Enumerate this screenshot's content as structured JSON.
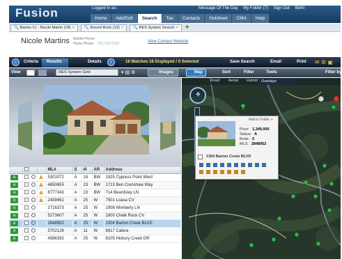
{
  "header": {
    "logo": "Fusion",
    "logged_in": "Logged in as:",
    "top_links": [
      "Message Of The Day",
      "My Folder (7)",
      "Sign Out",
      "BeNI"
    ],
    "nav_tabs": [
      "Home",
      "Add/Edit",
      "Search",
      "Tax",
      "Contacts",
      "Hotsheet",
      "CMA",
      "Help"
    ],
    "active_nav": "Search"
  },
  "doc_tabs": [
    "Barton Cr - Nicole Martin (18)",
    "Round Rock (13)",
    "RES System Search"
  ],
  "contact": {
    "name": "Nicole Martins",
    "mobile_label": "Mobile Phone",
    "home_label": "Home Phone",
    "phone_value": "555-555-5555",
    "website_link": "View Contact Website"
  },
  "toolbar1": {
    "criteria": "Criteria",
    "results": "Results",
    "details": "Details",
    "counts": "18 Matches   18 Displayed / 0 Selected",
    "save_search": "Save Search",
    "email": "Email",
    "print": "Print"
  },
  "toolbar2": {
    "view_label": "View",
    "grid_select": "RES System Grid",
    "images": "Images",
    "map": "Map",
    "sort": "Sort",
    "filter": "Filter",
    "tools": "Tools",
    "filter_by": "Filter by"
  },
  "grid": {
    "columns": [
      "ML#",
      "S",
      "#I",
      "AR",
      "Address"
    ],
    "rows": [
      {
        "status": "A",
        "ml": "5301072",
        "s": "A",
        "i": "14",
        "ar": "BW",
        "address": "1925 Cypress Point West",
        "warn": true
      },
      {
        "status": "A",
        "ml": "4650655",
        "s": "A",
        "i": "23",
        "ar": "BW",
        "address": "1713 Ben Crenshaw Way",
        "warn": true
      },
      {
        "status": "A",
        "ml": "6777343",
        "s": "A",
        "i": "23",
        "ar": "BW",
        "address": "714 Beardsley LN",
        "warn": true
      },
      {
        "status": "A",
        "ml": "2439451",
        "s": "A",
        "i": "25",
        "ar": "W",
        "address": "7501 Loasa CV",
        "warn": true
      },
      {
        "status": "A",
        "ml": "2716373",
        "s": "A",
        "i": "25",
        "ar": "W",
        "address": "1908 Wimberly LN",
        "warn": false
      },
      {
        "status": "A",
        "ml": "5273607",
        "s": "A",
        "i": "25",
        "ar": "W",
        "address": "1800 Chalk Rock CV",
        "warn": false
      },
      {
        "status": "A",
        "ml": "2848952",
        "s": "A",
        "i": "25",
        "ar": "W",
        "address": "1304 Barton Creek BLVD",
        "warn": false,
        "selected": true
      },
      {
        "status": "A",
        "ml": "5702128",
        "s": "A",
        "i": "11",
        "ar": "W",
        "address": "8917 Calera",
        "warn": false
      },
      {
        "status": "A",
        "ml": "4586392",
        "s": "A",
        "i": "25",
        "ar": "W",
        "address": "8105 Hickory Creek DR",
        "warn": false
      }
    ]
  },
  "map": {
    "tabs": [
      "Road",
      "Aerial",
      "Hybrid"
    ],
    "overlays": "Overlays",
    "popup": {
      "add_to_folder": "Add to Folder",
      "price_label": "Price:",
      "price": "1,349,000",
      "status_label": "Status:",
      "status": "A",
      "beds_label": "Beds:",
      "beds": "5",
      "mls_label": "MLS:",
      "mls": "2848952",
      "address": "1304 Barton Creek BLVD"
    }
  },
  "colors": {
    "header_blue": "#133a60",
    "status_green": "#2e9a36",
    "selected_row": "#b9d3f1",
    "map_dark": "#1a2a22"
  }
}
